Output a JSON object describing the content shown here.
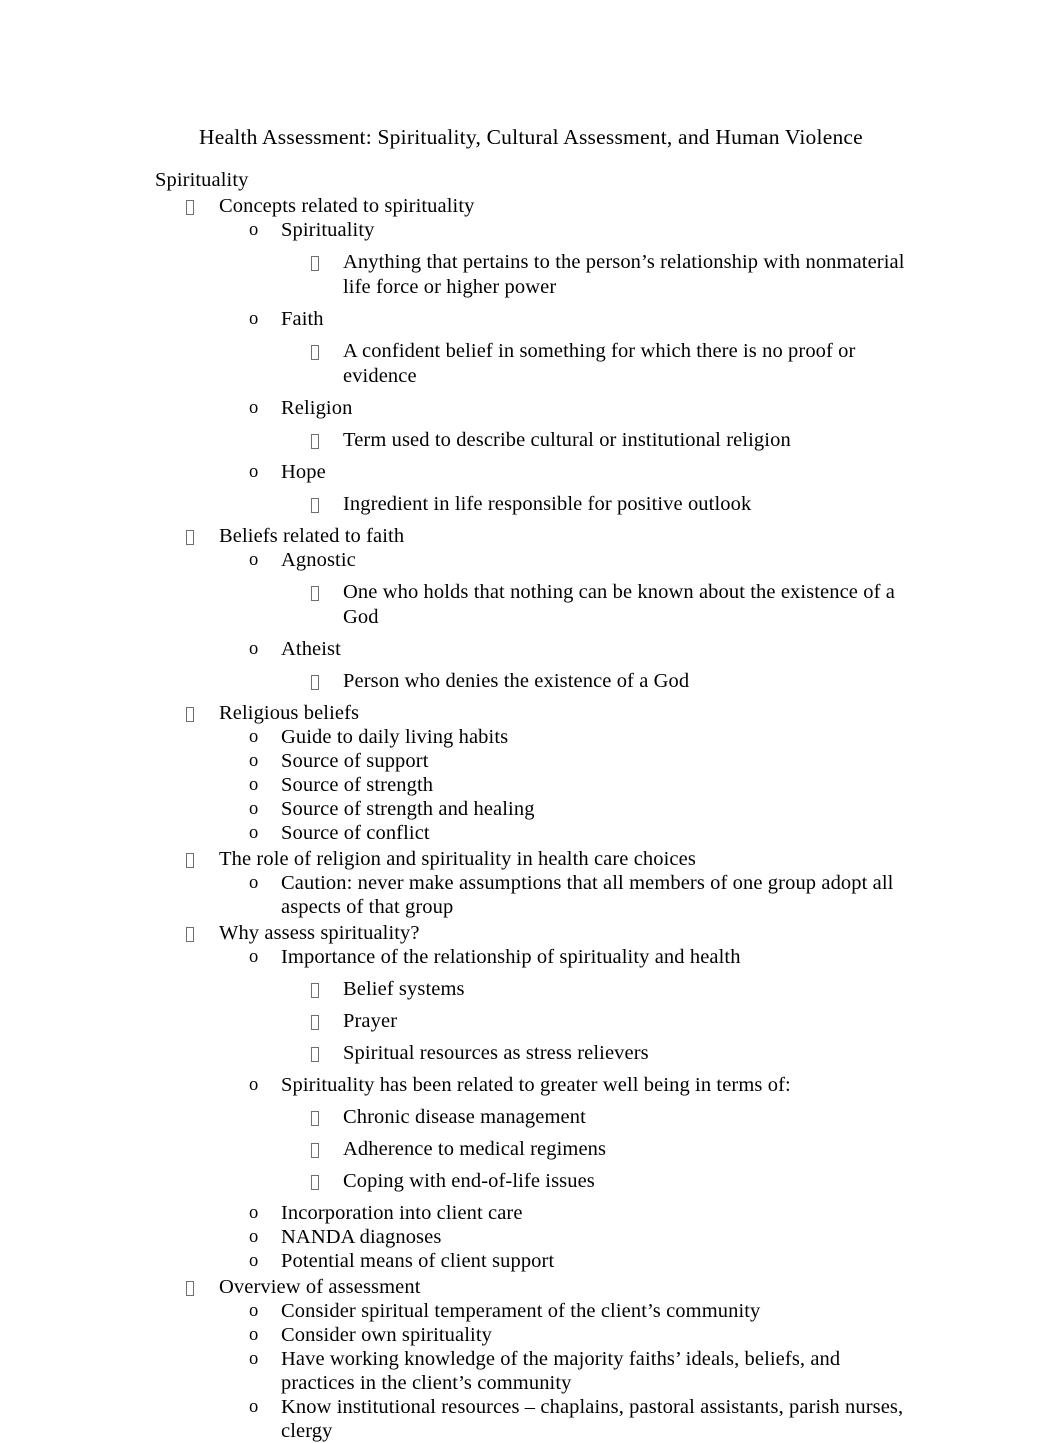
{
  "document": {
    "title": "Health Assessment: Spirituality, Cultural Assessment, and Human Violence",
    "background_color": "#ffffff",
    "text_color": "#000000",
    "bullet_box_color": "#6f6f6f",
    "markers": {
      "level1": "□",
      "level2": "o",
      "level3": "□"
    }
  },
  "outline": {
    "root_heading": "Spirituality",
    "items": [
      {
        "level": 1,
        "text": "Concepts related to spirituality"
      },
      {
        "level": 2,
        "text": "Spirituality"
      },
      {
        "level": 3,
        "text": "Anything that pertains to the person’s relationship with nonmaterial life force or higher power"
      },
      {
        "level": 2,
        "text": "Faith"
      },
      {
        "level": 3,
        "text": "A confident belief in something for which there is no proof or evidence"
      },
      {
        "level": 2,
        "text": "Religion"
      },
      {
        "level": 3,
        "text": "Term used to describe cultural or institutional religion"
      },
      {
        "level": 2,
        "text": "Hope"
      },
      {
        "level": 3,
        "text": "Ingredient in life responsible for positive outlook"
      },
      {
        "level": 1,
        "text": "Beliefs related to faith"
      },
      {
        "level": 2,
        "text": "Agnostic"
      },
      {
        "level": 3,
        "text": "One who holds that nothing can be known about the existence of a God"
      },
      {
        "level": 2,
        "text": "Atheist"
      },
      {
        "level": 3,
        "text": "Person who denies the existence of a God"
      },
      {
        "level": 1,
        "text": "Religious beliefs"
      },
      {
        "level": 2,
        "text": "Guide to daily living habits"
      },
      {
        "level": 2,
        "text": "Source of support"
      },
      {
        "level": 2,
        "text": "Source of strength"
      },
      {
        "level": 2,
        "text": "Source of strength and healing"
      },
      {
        "level": 2,
        "text": "Source of conflict"
      },
      {
        "level": 1,
        "text": "The role of religion and spirituality in health care choices"
      },
      {
        "level": 2,
        "text": "Caution: never make assumptions that all members of one group adopt all aspects of that group"
      },
      {
        "level": 1,
        "text": "Why assess spirituality?"
      },
      {
        "level": 2,
        "text": "Importance of the relationship of spirituality and health"
      },
      {
        "level": 3,
        "text": "Belief systems"
      },
      {
        "level": 3,
        "text": "Prayer"
      },
      {
        "level": 3,
        "text": "Spiritual resources as stress relievers"
      },
      {
        "level": 2,
        "text": "Spirituality has been related to greater well being in terms of:"
      },
      {
        "level": 3,
        "text": "Chronic disease management"
      },
      {
        "level": 3,
        "text": "Adherence to medical regimens"
      },
      {
        "level": 3,
        "text": "Coping with end-of-life issues"
      },
      {
        "level": 2,
        "text": "Incorporation into client care"
      },
      {
        "level": 2,
        "text": "NANDA diagnoses"
      },
      {
        "level": 2,
        "text": "Potential means of client support"
      },
      {
        "level": 1,
        "text": "Overview of assessment"
      },
      {
        "level": 2,
        "text": "Consider spiritual temperament of the client’s community"
      },
      {
        "level": 2,
        "text": "Consider own spirituality"
      },
      {
        "level": 2,
        "text": "Have working knowledge of the majority faiths’ ideals, beliefs, and practices in the client’s community"
      },
      {
        "level": 2,
        "text": "Know institutional resources – chaplains, pastoral assistants, parish nurses, clergy"
      }
    ]
  }
}
